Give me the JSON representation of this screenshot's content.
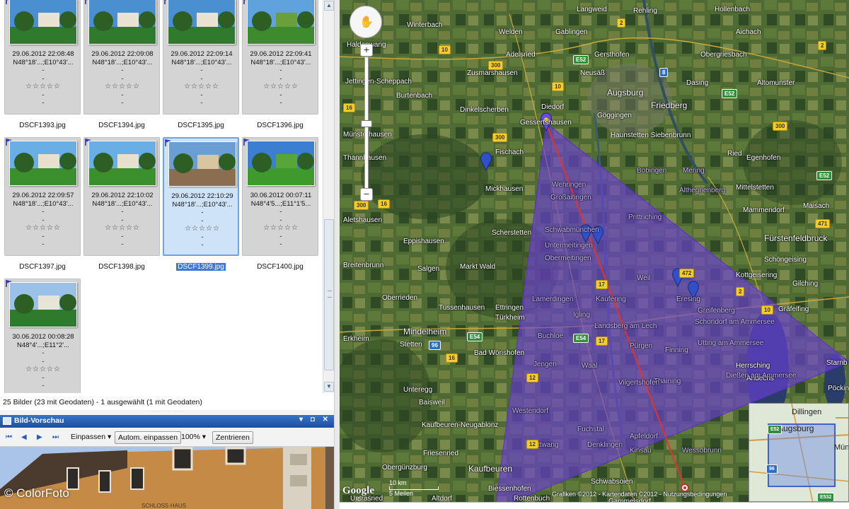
{
  "thumbnails": [
    {
      "date": "29.06.2012 22:08:48",
      "coords": "N48°18'...;E10°43'...",
      "stars": "☆☆☆☆☆",
      "file": "DSCF1393.jpg"
    },
    {
      "date": "29.06.2012 22:09:08",
      "coords": "N48°18'...;E10°43'...",
      "stars": "☆☆☆☆☆",
      "file": "DSCF1394.jpg"
    },
    {
      "date": "29.06.2012 22:09:14",
      "coords": "N48°18'...;E10°43'...",
      "stars": "☆☆☆☆☆",
      "file": "DSCF1395.jpg"
    },
    {
      "date": "29.06.2012 22:09:41",
      "coords": "N48°18'...;E10°43'...",
      "stars": "☆☆☆☆☆",
      "file": "DSCF1396.jpg"
    },
    {
      "date": "29.06.2012 22:09:57",
      "coords": "N48°18'...;E10°43'...",
      "stars": "☆☆☆☆☆",
      "file": "DSCF1397.jpg"
    },
    {
      "date": "29.06.2012 22:10:02",
      "coords": "N48°18'...;E10°43'...",
      "stars": "☆☆☆☆☆",
      "file": "DSCF1398.jpg"
    },
    {
      "date": "29.06.2012 22:10:29",
      "coords": "N48°18'...;E10°43'...",
      "stars": "☆☆☆☆☆",
      "file": "DSCF1399.jpg"
    },
    {
      "date": "30.06.2012 00:07:11",
      "coords": "N48°4'5...;E11°1'5...",
      "stars": "☆☆☆☆☆",
      "file": "DSCF1400.jpg"
    },
    {
      "date": "30.06.2012 00:08:28",
      "coords": "N48°4'...;E11°2'...",
      "stars": "☆☆☆☆☆",
      "file": ""
    }
  ],
  "placeholder_dash": "-",
  "status": "25 Bilder (23 mit Geodaten) - 1 ausgewählt (1 mit Geodaten)",
  "preview": {
    "title": "Bild-Vorschau",
    "window_controls": "▾ ◘ ✕",
    "fit_label": "Einpassen",
    "auto_fit_label": "Autom. einpassen",
    "zoom_value": "100%",
    "center_label": "Zentrieren",
    "nav_first": "⏮",
    "nav_prev": "◀",
    "nav_next": "▶",
    "nav_last": "⏭",
    "caret": "▾",
    "sign_text": "SCHLOSS·HAUS"
  },
  "watermark": "© ColorFoto",
  "scroll": {
    "up": "▲",
    "down": "▼"
  },
  "map": {
    "places": [
      {
        "name": "Langweid",
        "big": false
      },
      {
        "name": "Rehling",
        "big": false
      },
      {
        "name": "Hollenbach",
        "big": false
      },
      {
        "name": "Welden",
        "big": false
      },
      {
        "name": "Gablingen",
        "big": false
      },
      {
        "name": "Aichach",
        "big": false
      },
      {
        "name": "Winterbach",
        "big": false
      },
      {
        "name": "Haldenwang",
        "big": false
      },
      {
        "name": "Adelsried",
        "big": false
      },
      {
        "name": "Gersthofen",
        "big": false
      },
      {
        "name": "Obergriesbach",
        "big": false
      },
      {
        "name": "Zusmarshausen",
        "big": false
      },
      {
        "name": "Neusäß",
        "big": false
      },
      {
        "name": "Jettingen-Scheppach",
        "big": false
      },
      {
        "name": "Augsburg",
        "big": true
      },
      {
        "name": "Dasing",
        "big": false
      },
      {
        "name": "Altomunster",
        "big": false
      },
      {
        "name": "Friedberg",
        "big": true
      },
      {
        "name": "Burtenbach",
        "big": false
      },
      {
        "name": "Dinkelscherben",
        "big": false
      },
      {
        "name": "Diedorf",
        "big": false
      },
      {
        "name": "Gessertshausen",
        "big": false
      },
      {
        "name": "Göggingen",
        "big": false
      },
      {
        "name": "Haunstetten Siebenbrunn",
        "big": false
      },
      {
        "name": "Münsterhausen",
        "big": false
      },
      {
        "name": "Fischach",
        "big": false
      },
      {
        "name": "Thannhausen",
        "big": false
      },
      {
        "name": "Bobingen",
        "big": false
      },
      {
        "name": "Mering",
        "big": false
      },
      {
        "name": "Ried",
        "big": false
      },
      {
        "name": "Egenhofen",
        "big": false
      },
      {
        "name": "Mickhausen",
        "big": false
      },
      {
        "name": "Wehringen",
        "big": false
      },
      {
        "name": "Großaitingen",
        "big": false
      },
      {
        "name": "Althegnenberg",
        "big": false
      },
      {
        "name": "Mittelstetten",
        "big": false
      },
      {
        "name": "Aletshausen",
        "big": false
      },
      {
        "name": "Scherstetten",
        "big": false
      },
      {
        "name": "Schwabmünchen",
        "big": false
      },
      {
        "name": "Prittriching",
        "big": false
      },
      {
        "name": "Mammendorf",
        "big": false
      },
      {
        "name": "Maisach",
        "big": false
      },
      {
        "name": "Eppishausen",
        "big": false
      },
      {
        "name": "Untermeitingen",
        "big": false
      },
      {
        "name": "Obermeitingen",
        "big": false
      },
      {
        "name": "Fürstenfeldbruck",
        "big": true
      },
      {
        "name": "Breitenbrunn",
        "big": false
      },
      {
        "name": "Salgen",
        "big": false
      },
      {
        "name": "Markt Wald",
        "big": false
      },
      {
        "name": "Schöngeising",
        "big": false
      },
      {
        "name": "Weil",
        "big": false
      },
      {
        "name": "Eresing",
        "big": false
      },
      {
        "name": "Kottgeisering",
        "big": false
      },
      {
        "name": "Gilching",
        "big": false
      },
      {
        "name": "Oberrieden",
        "big": false
      },
      {
        "name": "Tussenhausen",
        "big": false
      },
      {
        "name": "Ettringen",
        "big": false
      },
      {
        "name": "Lamerdingen",
        "big": false
      },
      {
        "name": "Kaufering",
        "big": false
      },
      {
        "name": "Greifenberg",
        "big": false
      },
      {
        "name": "Gräfelfing",
        "big": false
      },
      {
        "name": "Mindelheim",
        "big": true
      },
      {
        "name": "Türkheim",
        "big": false
      },
      {
        "name": "Igling",
        "big": false
      },
      {
        "name": "Landsberg am Lech",
        "big": false
      },
      {
        "name": "Schondorf am Ammersee",
        "big": false
      },
      {
        "name": "Erkheim",
        "big": false
      },
      {
        "name": "Stetten",
        "big": false
      },
      {
        "name": "Buchloe",
        "big": false
      },
      {
        "name": "Pürgen",
        "big": false
      },
      {
        "name": "Utting am Ammersee",
        "big": false
      },
      {
        "name": "Bad Wörishofen",
        "big": false
      },
      {
        "name": "Jengen",
        "big": false
      },
      {
        "name": "Waal",
        "big": false
      },
      {
        "name": "Finning",
        "big": false
      },
      {
        "name": "Herrsching",
        "big": false
      },
      {
        "name": "Starnb",
        "big": false
      },
      {
        "name": "Andechs",
        "big": false
      },
      {
        "name": "Unteregg",
        "big": false
      },
      {
        "name": "Thaining",
        "big": false
      },
      {
        "name": "Pöcking",
        "big": false
      },
      {
        "name": "Baisweil",
        "big": false
      },
      {
        "name": "Westendorf",
        "big": false
      },
      {
        "name": "Vilgertshofen",
        "big": false
      },
      {
        "name": "Dießen am Ammersee",
        "big": false
      },
      {
        "name": "Kaufbeuren-Neugablonz",
        "big": false
      },
      {
        "name": "Fuchstal",
        "big": false
      },
      {
        "name": "Denklingen",
        "big": false
      },
      {
        "name": "Apfeldorf",
        "big": false
      },
      {
        "name": "Kaufbeuren",
        "big": true
      },
      {
        "name": "Stöttwang",
        "big": false
      },
      {
        "name": "Friesenried",
        "big": false
      },
      {
        "name": "Kinsau",
        "big": false
      },
      {
        "name": "Wessobrunn",
        "big": false
      },
      {
        "name": "Obergünzburg",
        "big": false
      },
      {
        "name": "Schwabsoien",
        "big": false
      },
      {
        "name": "Biessenhofen",
        "big": false
      },
      {
        "name": "Untrasried",
        "big": false
      },
      {
        "name": "Altdorf",
        "big": false
      },
      {
        "name": "Rottenbuch",
        "big": false
      },
      {
        "name": "Gammelsdorf",
        "big": false
      }
    ],
    "roads": [
      {
        "label": "2",
        "kind": "y"
      },
      {
        "label": "10",
        "kind": "y"
      },
      {
        "label": "300",
        "kind": "y"
      },
      {
        "label": "10",
        "kind": "y"
      },
      {
        "label": "E52",
        "kind": "g"
      },
      {
        "label": "8",
        "kind": "b"
      },
      {
        "label": "E52",
        "kind": "g"
      },
      {
        "label": "2",
        "kind": "y"
      },
      {
        "label": "300",
        "kind": "y"
      },
      {
        "label": "16",
        "kind": "y"
      },
      {
        "label": "300",
        "kind": "y"
      },
      {
        "label": "16",
        "kind": "y"
      },
      {
        "label": "17",
        "kind": "y"
      },
      {
        "label": "96",
        "kind": "b"
      },
      {
        "label": "E54",
        "kind": "g"
      },
      {
        "label": "12",
        "kind": "y"
      },
      {
        "label": "16",
        "kind": "y"
      },
      {
        "label": "17",
        "kind": "y"
      },
      {
        "label": "2",
        "kind": "y"
      },
      {
        "label": "471",
        "kind": "y"
      },
      {
        "label": "E52",
        "kind": "g"
      },
      {
        "label": "E54",
        "kind": "g"
      },
      {
        "label": "12",
        "kind": "y"
      },
      {
        "label": "472",
        "kind": "y"
      },
      {
        "label": "10",
        "kind": "y"
      },
      {
        "label": "E532",
        "kind": "g"
      },
      {
        "label": "300",
        "kind": "y"
      }
    ],
    "scale": "10 km",
    "scale_miles": "5 Meilen",
    "attribution": "Grafiken ©2012 - Kartendaten ©2012 - Nutzungsbedingungen",
    "google": "Google",
    "copyright_small": "©",
    "nav_icon": "✋",
    "zoom_in": "+",
    "zoom_out": "−",
    "overview": {
      "dillingen": "Dillingen",
      "augsburg": "Augsburg",
      "munchen": "Münc",
      "e52": "E52",
      "e532": "E532",
      "nine": "96"
    },
    "colors": {
      "triangle": "#6a3fd6",
      "track": "#e0342c",
      "marker": "#3150c8",
      "start_marker": "#f2d23a"
    }
  }
}
